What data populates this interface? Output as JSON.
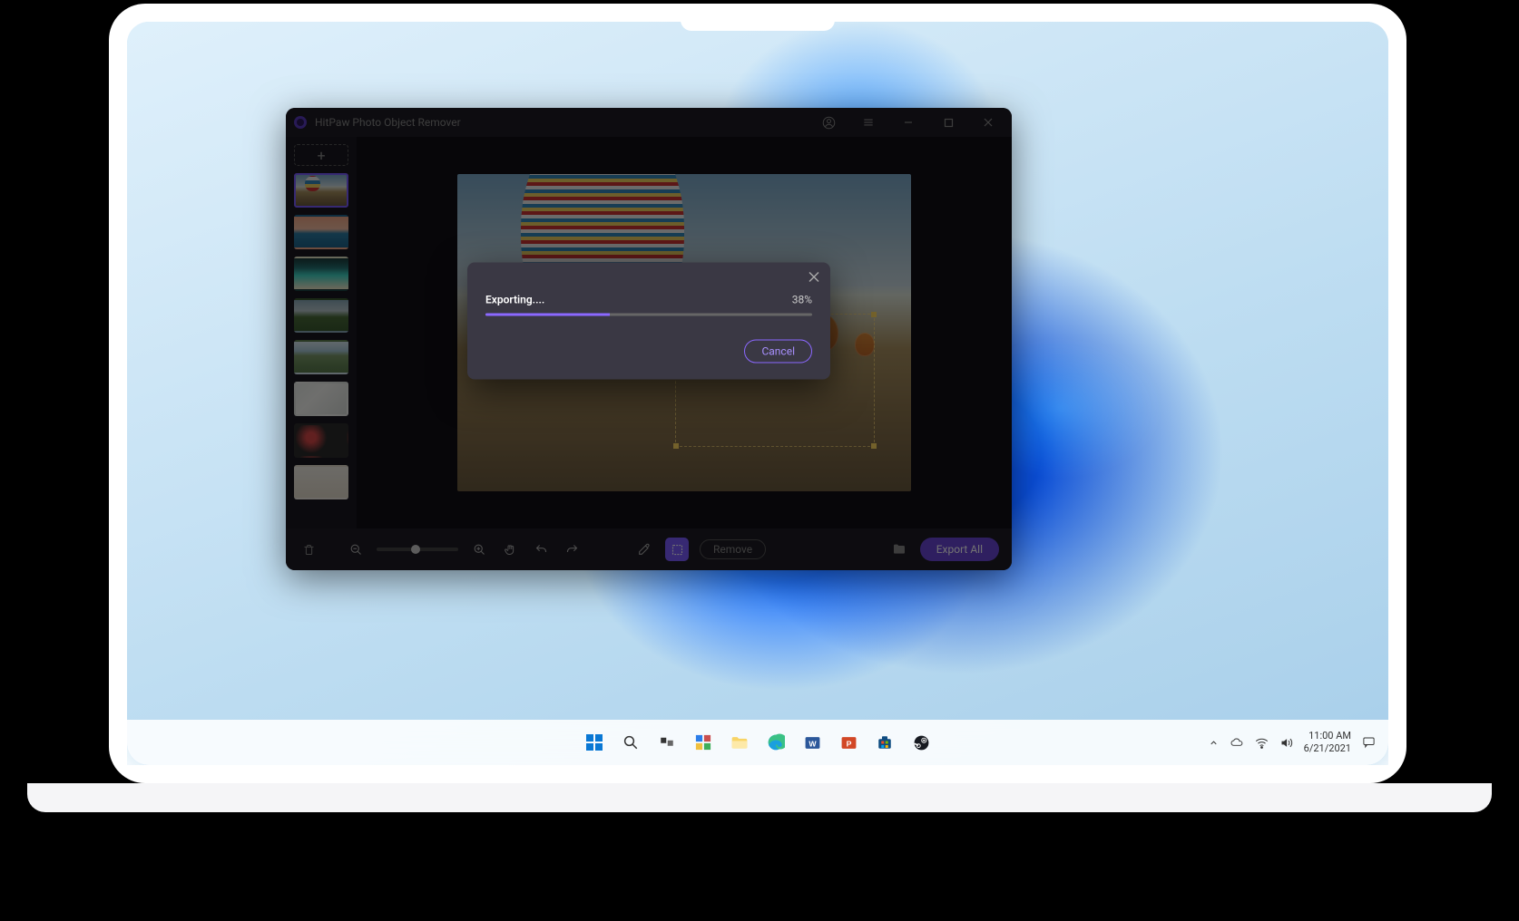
{
  "app": {
    "title": "HitPaw Photo Object Remover",
    "sidebar": {
      "add_label": "+",
      "delete_tooltip": "Delete",
      "thumbnails": [
        {
          "selected": true,
          "scene": "balloon"
        },
        {
          "selected": false,
          "scene": "sunset"
        },
        {
          "selected": false,
          "scene": "beach"
        },
        {
          "selected": false,
          "scene": "field"
        },
        {
          "selected": false,
          "scene": "lake"
        },
        {
          "selected": false,
          "scene": "desk"
        },
        {
          "selected": false,
          "scene": "food"
        },
        {
          "selected": false,
          "scene": "plate"
        }
      ]
    },
    "toolbar": {
      "remove_label": "Remove",
      "export_all_label": "Export All"
    },
    "dialog": {
      "status_label": "Exporting....",
      "percent_text": "38%",
      "percent_value": 38,
      "cancel_label": "Cancel"
    }
  },
  "taskbar": {
    "time": "11:00 AM",
    "date": "6/21/2021"
  },
  "colors": {
    "accent": "#7b5cff",
    "app_bg": "#1a1820",
    "dialog_bg": "#3a3844"
  }
}
